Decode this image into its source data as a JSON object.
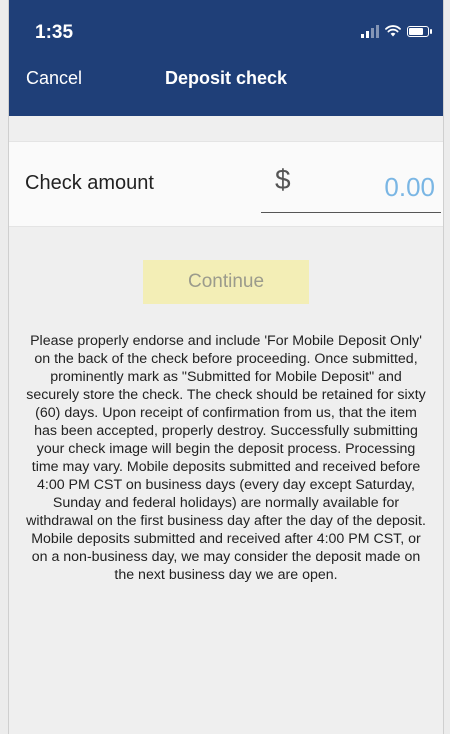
{
  "status_bar": {
    "time": "1:35"
  },
  "nav": {
    "cancel_label": "Cancel",
    "title": "Deposit check"
  },
  "amount": {
    "label": "Check amount",
    "currency_symbol": "$",
    "placeholder": "0.00"
  },
  "continue_label": "Continue",
  "disclaimer": "Please properly endorse and include 'For Mobile Deposit Only' on the back of the check before proceeding. Once submitted, prominently mark as \"Submitted for Mobile Deposit\" and securely store the check. The check should be retained for sixty (60) days. Upon receipt of confirmation from us, that the item has been accepted, properly destroy. Successfully submitting your check image will begin the deposit process. Processing time may vary. Mobile deposits submitted and received before 4:00 PM CST on business days (every day except Saturday, Sunday and federal holidays) are normally available for withdrawal on the first business day after the day of the deposit. Mobile deposits submitted and received after 4:00 PM CST, or on a non-business day, we may consider the deposit made on the next business day we are open.",
  "colors": {
    "header_bg": "#1f3f78",
    "amount_text": "#6aaee0",
    "continue_bg": "#f3eeb6"
  },
  "icons": {
    "signal": "signal-icon",
    "wifi": "wifi-icon",
    "battery": "battery-icon"
  }
}
